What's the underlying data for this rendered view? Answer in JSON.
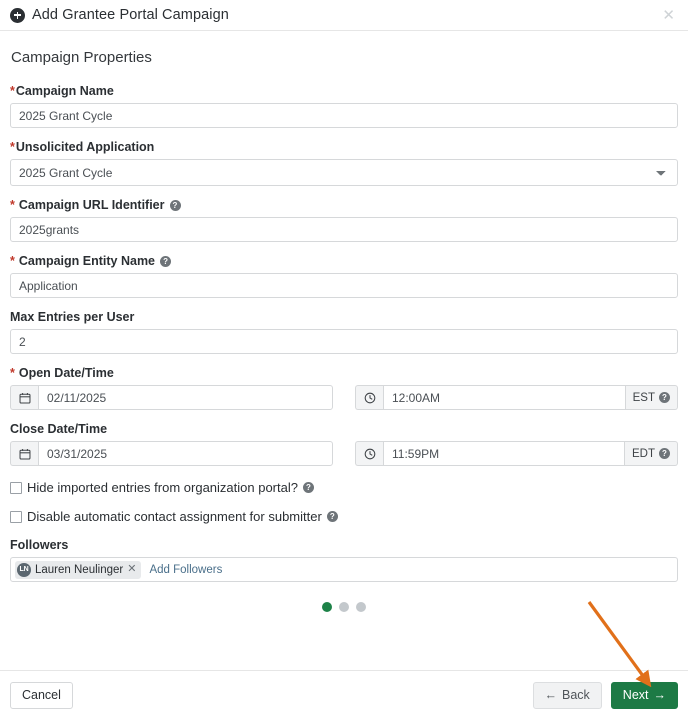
{
  "header": {
    "icon": "add-circle-icon",
    "title": "Add Grantee Portal Campaign",
    "close_label": "✕"
  },
  "section": {
    "title": "Campaign Properties"
  },
  "fields": {
    "campaign_name": {
      "label": "Campaign Name",
      "required": true,
      "value": "2025 Grant Cycle"
    },
    "unsolicited_application": {
      "label": "Unsolicited Application",
      "required": true,
      "value": "2025 Grant Cycle"
    },
    "campaign_url_identifier": {
      "label": "Campaign URL Identifier",
      "required": true,
      "help": "?",
      "value": "2025grants"
    },
    "campaign_entity_name": {
      "label": "Campaign Entity Name",
      "required": true,
      "help": "?",
      "value": "Application"
    },
    "max_entries_per_user": {
      "label": "Max Entries per User",
      "required": false,
      "value": "2"
    },
    "open_datetime": {
      "label": "Open Date/Time",
      "required": true,
      "date_value": "02/11/2025",
      "time_value": "12:00AM",
      "timezone": "EST",
      "timezone_help": "?"
    },
    "close_datetime": {
      "label": "Close Date/Time",
      "required": false,
      "date_value": "03/31/2025",
      "time_value": "11:59PM",
      "timezone": "EDT",
      "timezone_help": "?"
    }
  },
  "checkboxes": [
    {
      "label": "Hide imported entries from organization portal?",
      "checked": false,
      "help": "?"
    },
    {
      "label": "Disable automatic contact assignment for submitter",
      "checked": false,
      "help": "?"
    }
  ],
  "followers": {
    "label": "Followers",
    "chip": {
      "initials": "LN",
      "name": "Lauren Neulinger",
      "remove": "✕"
    },
    "add_link": "Add Followers"
  },
  "pagination": {
    "total": 3,
    "active_index": 0
  },
  "footer": {
    "cancel_label": "Cancel",
    "back_label": "Back",
    "back_arrow": "←",
    "next_label": "Next",
    "next_arrow": "→"
  },
  "colors": {
    "primary_green": "#1d7a45",
    "required_red": "#c0392b",
    "annotation_orange": "#e1701a",
    "link_blue": "#4a6f8a"
  }
}
